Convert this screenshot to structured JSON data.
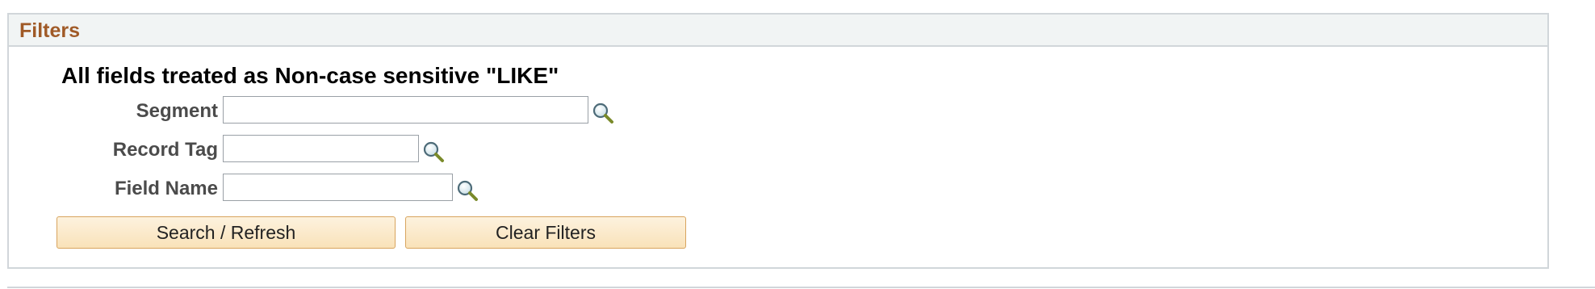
{
  "filters": {
    "title": "Filters",
    "note": "All fields treated as Non-case sensitive \"LIKE\"",
    "fields": [
      {
        "label": "Segment",
        "value": "",
        "lookup_icon": "magnifier-icon"
      },
      {
        "label": "Record Tag",
        "value": "",
        "lookup_icon": "magnifier-icon"
      },
      {
        "label": "Field Name",
        "value": "",
        "lookup_icon": "magnifier-icon"
      }
    ],
    "buttons": {
      "search_refresh": "Search / Refresh",
      "clear_filters": "Clear Filters"
    }
  },
  "colors": {
    "title": "#a05a27",
    "header_bg": "#f1f4f4",
    "border": "#d1d6da",
    "button_bg": "#f9e2b9",
    "button_border": "#d8a45e"
  }
}
